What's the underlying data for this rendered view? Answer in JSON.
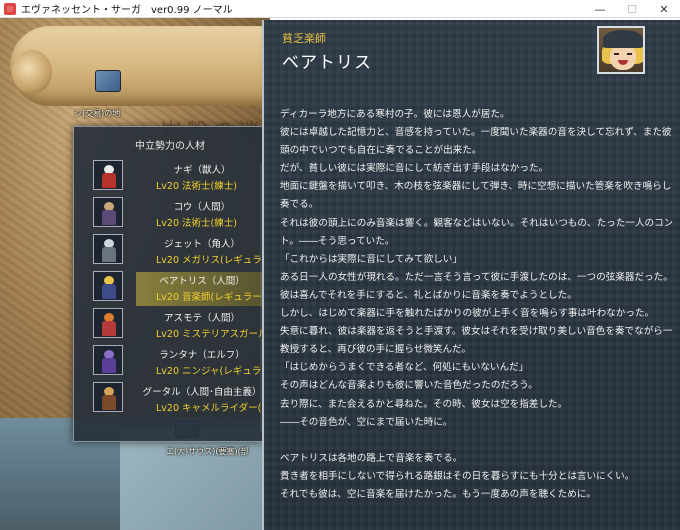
{
  "window": {
    "title": "エヴァネッセント・サーガ　ver0.99 ノーマル",
    "minimize": "—",
    "maximize": "☐",
    "close": "✕"
  },
  "map": {
    "ghost_title": "岩盤の迷",
    "labels": [
      "ジ(交易)の地",
      "エ(大)サウス)(要塞)(部"
    ]
  },
  "recruit_list": {
    "header": "中立勢力の人材",
    "items": [
      {
        "name": "ナギ（獣人）",
        "class": "Lv20 法術士(練士)",
        "head_color": "#e8e8e8",
        "body_color": "#b8322c",
        "selected": false
      },
      {
        "name": "コウ（人間）",
        "class": "Lv20 法術士(練士)",
        "head_color": "#c9a57a",
        "body_color": "#5c4a78",
        "selected": false
      },
      {
        "name": "ジェット（角人）",
        "class": "Lv20 メガリス(レギュラー)",
        "head_color": "#cfd6dd",
        "body_color": "#6a7480",
        "selected": false
      },
      {
        "name": "ベアトリス（人間）",
        "class": "Lv20 音楽師(レギュラー)",
        "head_color": "#e8c24a",
        "body_color": "#3e4a8a",
        "selected": true
      },
      {
        "name": "アスモテ（人間）",
        "class": "Lv20 ミステリアスガール(密偵",
        "head_color": "#e07d2e",
        "body_color": "#b53a3a",
        "selected": false
      },
      {
        "name": "ランタナ（エルフ）",
        "class": "Lv20 ニンジャ(レギュラー)",
        "head_color": "#8a6fc8",
        "body_color": "#5a3e9a",
        "selected": false
      },
      {
        "name": "グータル（人間･自由主義）",
        "class": "Lv20 キャメルライダー(レギュラ",
        "head_color": "#d7a25a",
        "body_color": "#7a4a2a",
        "selected": false
      }
    ]
  },
  "character": {
    "title": "貧乏楽師",
    "name": "ベアトリス",
    "bio": [
      "ディカーラ地方にある寒村の子。彼には恩人が居た。",
      "彼には卓越した記憶力と、音感を持っていた。一度聞いた楽器の音を決して忘れず、また彼自身の",
      "頭の中でいつでも自在に奏でることが出来た。",
      "だが、貧しい彼には実際に音にして紡ぎ出す手段はなかった。",
      "地面に鍵盤を描いて叩き、木の枝を弦楽器にして弾き、時に空想に描いた管楽を吹き鳴らし音楽を",
      "奏でる。",
      "それは彼の頭上にのみ音楽は響く。観客などはいない。それはいつもの、たった一人のコンサー",
      "ト。――そう思っていた。",
      "「これからは実際に音にしてみて欲しい」",
      "ある日一人の女性が現れる。ただ一言そう言って彼に手渡したのは、一つの弦楽器だった。",
      "彼は喜んでそれを手にすると、礼とばかりに音楽を奏でようとした。",
      "しかし、はじめて楽器に手を触れたばかりの彼が上手く音を鳴らす事は叶わなかった。",
      "失意に暮れ、彼は楽器を返そうと手渡す。彼女はそれを受け取り美しい音色を奏でながら一度だけ",
      "教授すると、再び彼の手に握らせ微笑んだ。",
      "「はじめからうまくできる者など、何処にもいないんだ」",
      "その声はどんな音楽よりも彼に響いた音色だったのだろう。",
      "去り際に、また会えるかと尋ねた。その時、彼女は空を指差した。",
      "――その音色が、空にまで届いた時に。",
      "",
      "ベアトリスは各地の路上で音楽を奏でる。",
      "貴き者を相手にしないで得られる路銀はその日を暮らすにも十分とは言いにくい。",
      "それでも彼は、空に音楽を届けたかった。もう一度あの声を聴くために。"
    ]
  },
  "colors": {
    "accent_yellow": "#e8c440",
    "class_yellow": "#f0d030",
    "panel_bg": "#2e3b47",
    "selected_bg": "#968c3c"
  }
}
